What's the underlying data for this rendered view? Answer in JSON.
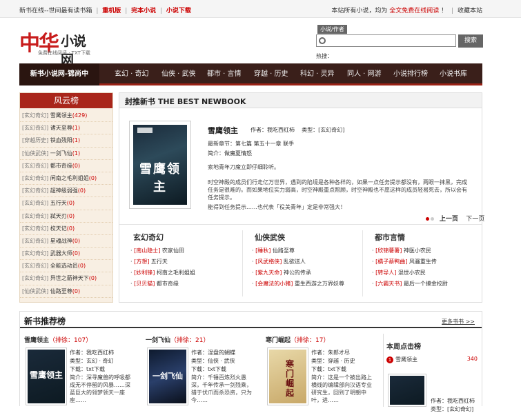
{
  "topbar": {
    "left1": "新书在线--世间最有读书箱",
    "link1": "重机版",
    "link2": "完本小说",
    "link3": "小说下载",
    "right_pre": "本站所有小说，均为",
    "right_red": "全文免费在线阅读",
    "right_post": "！",
    "bookmark": "收藏本站"
  },
  "logo": {
    "big": "中华",
    "big2": "小说网",
    "sub": "免费在线阅读 · TXT下载"
  },
  "search": {
    "label": "小说/作者",
    "button": "搜索",
    "hot": "热搜："
  },
  "nav": {
    "home": "新书小说网-锦尚中",
    "items": [
      "玄幻 · 奇幻",
      "仙侠 · 武侠",
      "都市 · 言情",
      "穿越 · 历史",
      "科幻 · 灵异",
      "同人 · 网游",
      "小说排行榜",
      "小说书库"
    ]
  },
  "fengyun": {
    "title": "风云榜",
    "items": [
      {
        "cat": "[玄幻奇幻]",
        "name": "雪鹰领主",
        "hits": "(429)"
      },
      {
        "cat": "[玄幻奇幻]",
        "name": "诸天至尊",
        "hits": "(1)"
      },
      {
        "cat": "[穿越历史]",
        "name": "铁血残阳",
        "hits": "(1)"
      },
      {
        "cat": "[仙侠武侠]",
        "name": "一剑飞仙",
        "hits": "(1)"
      },
      {
        "cat": "[玄幻奇幻]",
        "name": "都市奇缘",
        "hits": "(0)"
      },
      {
        "cat": "[玄幻奇幻]",
        "name": "闲南之毛利姐姐",
        "hits": "(0)"
      },
      {
        "cat": "[玄幻奇幻]",
        "name": "超神级弱强",
        "hits": "(0)"
      },
      {
        "cat": "[玄幻奇幻]",
        "name": "五行天",
        "hits": "(0)"
      },
      {
        "cat": "[玄幻奇幻]",
        "name": "弑天刃",
        "hits": "(0)"
      },
      {
        "cat": "[玄幻奇幻]",
        "name": "校天记",
        "hits": "(0)"
      },
      {
        "cat": "[玄幻奇幻]",
        "name": "星魂战神",
        "hits": "(0)"
      },
      {
        "cat": "[玄幻奇幻]",
        "name": "武器大师",
        "hits": "(0)"
      },
      {
        "cat": "[玄幻奇幻]",
        "name": "全能选动员",
        "hits": "(0)"
      },
      {
        "cat": "[玄幻奇幻]",
        "name": "异世之箭神天下",
        "hits": "(0)"
      },
      {
        "cat": "[仙侠武侠]",
        "name": "仙路至尊",
        "hits": "(0)"
      }
    ]
  },
  "featured": {
    "header": "封推新书 THE BEST NEWBOOK",
    "book": "雪鹰领主",
    "author_label": "作者：我吃西红柿",
    "type_label": "类型：[玄幻奇幻]",
    "latest_label": "最新章节：第七篇 第五十一章 联手",
    "latest2": "简介：做魔夏情怒",
    "desc1": "索地青年刀魔立即仔细聆听。",
    "desc2": "时空神殿的成员们行走亿万世界，遇到的陷境是各种各样的，如果一点任务提示都没有，两眼一抹黑，完成任务是很难的。而如果地位实力弱高，时空神殿重点照顾，时空神殿也不愿这样的成员轻易死去，所以会有任务提示。",
    "desc3": "能得到任务提示……也代表「役美青年」定是非常强大！",
    "prev": "上一页",
    "next": "下一页"
  },
  "columns": [
    {
      "title": "玄幻奇幻",
      "items": [
        {
          "tag": "[南山隐士]",
          "name": "农家仙田"
        },
        {
          "tag": "[方想]",
          "name": "五行天"
        },
        {
          "tag": "[妙利锋]",
          "name": "柯南之毛利姐姐"
        },
        {
          "tag": "[贝贝猫]",
          "name": "都市奇缘"
        }
      ]
    },
    {
      "title": "仙侠武侠",
      "items": [
        {
          "tag": "[睡秋]",
          "name": "仙路至尊"
        },
        {
          "tag": "[风武络侠]",
          "name": "乱欲送人"
        },
        {
          "tag": "[紫九天命]",
          "name": "神公的传承"
        },
        {
          "tag": "[会魔法的小猪]",
          "name": "重生西游之万界妖尊"
        }
      ]
    },
    {
      "title": "都市言情",
      "items": [
        {
          "tag": "[欣锦薯薯]",
          "name": "神医小农民"
        },
        {
          "tag": "[橘子蔡鸭曲]",
          "name": "风骚重生传"
        },
        {
          "tag": "[转导人]",
          "name": "混世小农民"
        },
        {
          "tag": "[六霸天书]",
          "name": "最后一个摸金校尉"
        }
      ]
    }
  ],
  "bottom": {
    "title": "新书推荐榜",
    "more": "更多书书 >>",
    "books": [
      {
        "name": "雪鹰领主",
        "rank": "（排徐：107）",
        "author": "作者：我吃西红柿",
        "type": "类型：玄幻 · 奇幻",
        "download": "下载：txt下载",
        "desc": "简介：深寻魔兽的呼吸都成无不停留的风暴……深蓝巨大的翎梦领天一座座……"
      },
      {
        "name": "一剑飞仙",
        "rank": "（排徐：21）",
        "author": "作者：涅盘的蝴蝶",
        "type": "类型：仙侠 · 武侠",
        "download": "下载：txt下载",
        "desc": "简介：千锤百炼烈火愚深，千年传承一剑残乘，猎于伏爪而杀恐资，只为今……"
      },
      {
        "name": "寒门崛起",
        "rank": "（排徐：17）",
        "author": "作者：朱郎才尽",
        "type": "类型：穿越 · 历史",
        "download": "下载：txt下载",
        "desc": "简介：这是一个被出路上横线的编辑部向汉语专业研究生，回到了明朝中叶，进……"
      }
    ]
  },
  "weekly": {
    "title": "本周点击榜",
    "first_num": "1",
    "first_name": "雪鹰领主",
    "first_count": "340",
    "author": "作者：我吃西红柿",
    "type": "类型：[玄幻奇幻]",
    "download": "下载：txt下载",
    "desc": "简介：深寻魔兽的"
  },
  "covers": {
    "c1": "雪鹰领主",
    "c2": "一剑飞仙",
    "c3": "寒门崛起"
  }
}
